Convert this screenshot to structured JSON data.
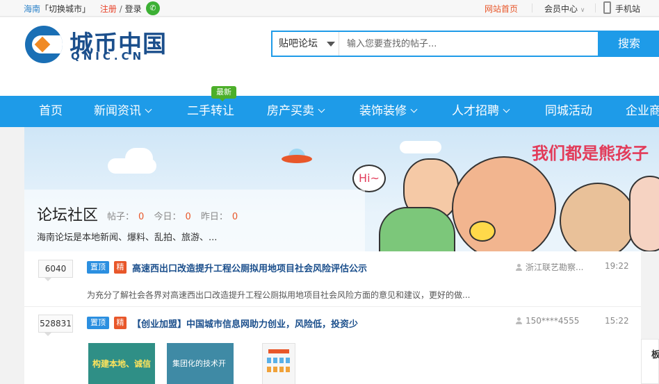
{
  "topbar": {
    "city": "海南",
    "switch_city": "「切换城市」",
    "register": "注册",
    "separator": "/",
    "login": "登录",
    "site_home": "网站首页",
    "member_center": "会员中心",
    "mobile_site": "手机站"
  },
  "logo": {
    "text": "城币中国",
    "sub": "QNIC.CN"
  },
  "search": {
    "category": "贴吧论坛",
    "placeholder": "输入您要查找的帖子...",
    "button": "搜索"
  },
  "nav": {
    "items": [
      "首页",
      "新闻资讯",
      "二手转让",
      "房产买卖",
      "装饰装修",
      "人才招聘",
      "同城活动",
      "企业商"
    ],
    "new_badge": "最新"
  },
  "banner": {
    "slogan": "我们都是熊孩子",
    "hi": "Hi~"
  },
  "forum": {
    "title": "论坛社区",
    "posts_label": "帖子：",
    "posts": "0",
    "today_label": "今日：",
    "today": "0",
    "yesterday_label": "昨日：",
    "yesterday": "0",
    "description": "海南论坛是本地新闻、爆料、乱拍、旅游、..."
  },
  "posts": [
    {
      "count": "6040",
      "tag_top": "置顶",
      "tag_jing": "精",
      "title": "高速西出口改造提升工程公厕拟用地项目社会风险评估公示",
      "author": "浙江联艺勘察...",
      "time": "19:22",
      "summary": "为充分了解社会各界对高速西出口改造提升工程公厕拟用地项目社会风险方面的意见和建议，更好的做..."
    },
    {
      "count": "528831",
      "tag_top": "置顶",
      "tag_jing": "精",
      "title": "【创业加盟】中国城市信息网助力创业，风险低，投资少",
      "author": "150****4555",
      "time": "15:22",
      "thumbs": [
        "构建本地、诚信",
        "集团化的技术开"
      ]
    }
  ],
  "side": {
    "label": "板"
  },
  "colors": {
    "brand_blue": "#1e9be8",
    "accent_orange": "#e8572a",
    "title_blue": "#1b4f8c"
  }
}
